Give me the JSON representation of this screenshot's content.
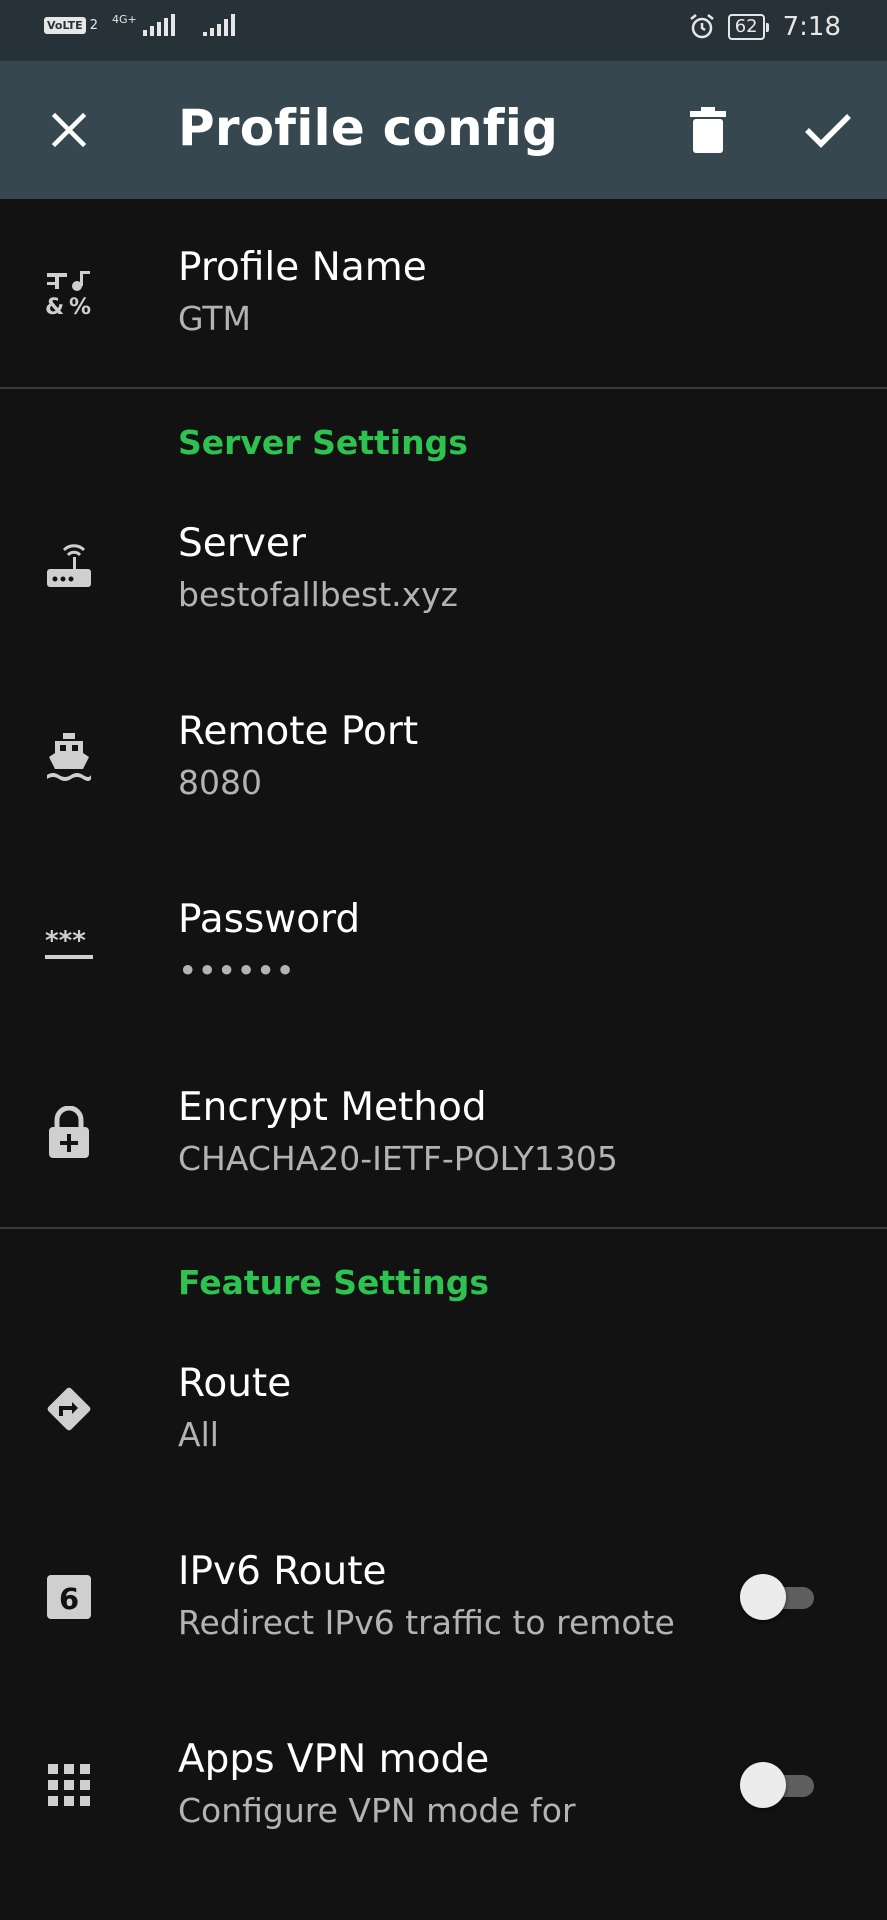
{
  "status_bar": {
    "volte": "VoLTE",
    "sim": "2",
    "network": "4G+",
    "battery": "62",
    "time": "7:18"
  },
  "toolbar": {
    "title": "Profile config"
  },
  "profile": {
    "name_label": "Profile Name",
    "name_value": "GTM"
  },
  "server_settings": {
    "header": "Server Settings",
    "server_label": "Server",
    "server_value": "bestofallbest.xyz",
    "port_label": "Remote Port",
    "port_value": "8080",
    "password_label": "Password",
    "password_value": "••••••",
    "encrypt_label": "Encrypt Method",
    "encrypt_value": "CHACHA20-IETF-POLY1305"
  },
  "feature_settings": {
    "header": "Feature Settings",
    "route_label": "Route",
    "route_value": "All",
    "ipv6_label": "IPv6 Route",
    "ipv6_summary": "Redirect IPv6 traffic to remote",
    "ipv6_enabled": false,
    "apps_label": "Apps VPN mode",
    "apps_summary": "Configure VPN mode for",
    "apps_enabled": false
  },
  "colors": {
    "status_bar": "#263238",
    "toolbar": "#37474f",
    "background": "#121212",
    "accent": "#2ec250"
  }
}
